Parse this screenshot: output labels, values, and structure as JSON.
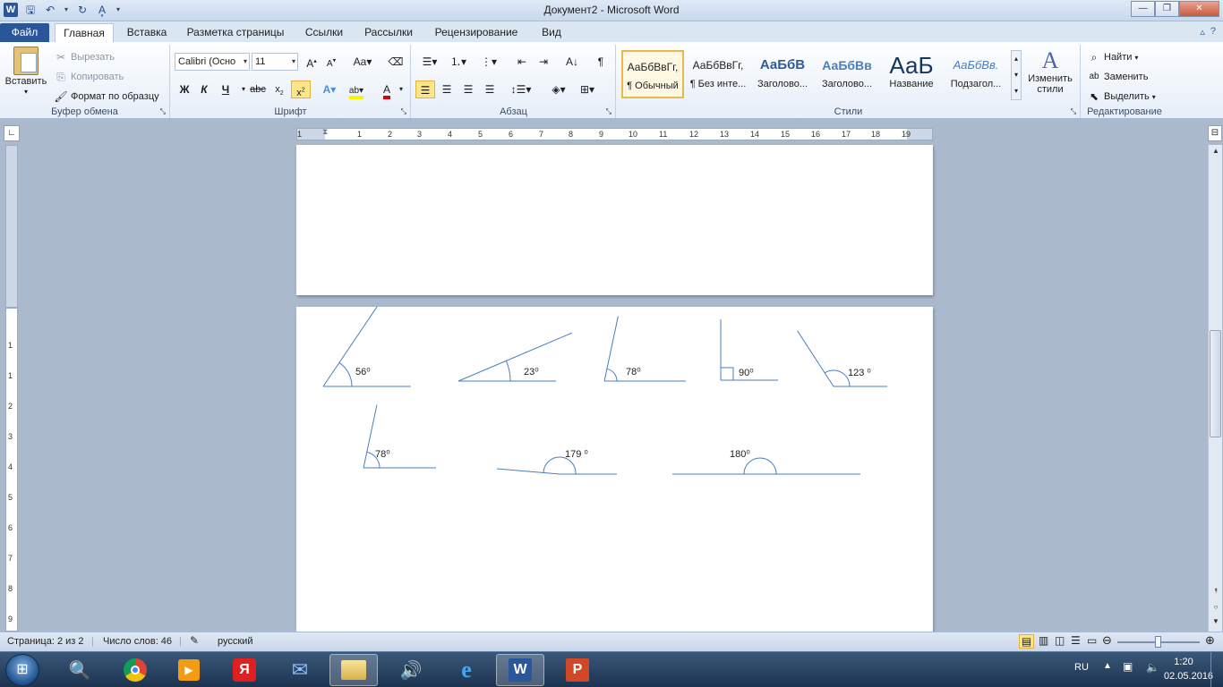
{
  "title_bar": {
    "window_title": "Документ2  -  Microsoft Word",
    "minimize": "—",
    "maximize": "❐",
    "close": "✕"
  },
  "tabs": [
    {
      "label": "Файл"
    },
    {
      "label": "Главная"
    },
    {
      "label": "Вставка"
    },
    {
      "label": "Разметка страницы"
    },
    {
      "label": "Ссылки"
    },
    {
      "label": "Рассылки"
    },
    {
      "label": "Рецензирование"
    },
    {
      "label": "Вид"
    }
  ],
  "ribbon": {
    "clipboard": {
      "label": "Буфер обмена",
      "paste": "Вставить",
      "cut": "Вырезать",
      "copy": "Копировать",
      "format_painter": "Формат по образцу"
    },
    "font": {
      "label": "Шрифт",
      "font_name": "Calibri (Осно",
      "font_size": "11"
    },
    "paragraph": {
      "label": "Абзац"
    },
    "styles": {
      "label": "Стили",
      "items": [
        {
          "sample": "АаБбВвГг,",
          "name": "¶ Обычный"
        },
        {
          "sample": "АаБбВвГг,",
          "name": "¶ Без инте..."
        },
        {
          "sample": "АаБбВ",
          "name": "Заголово..."
        },
        {
          "sample": "АаБбВв",
          "name": "Заголово..."
        },
        {
          "sample": "АаБ",
          "name": "Название"
        },
        {
          "sample": "АаБбВв.",
          "name": "Подзагол..."
        }
      ],
      "change_styles": "Изменить стили"
    },
    "editing": {
      "label": "Редактирование",
      "find": "Найти",
      "replace": "Заменить",
      "select": "Выделить"
    }
  },
  "ruler": {
    "labels": [
      "1",
      "1",
      "2",
      "3",
      "4",
      "5",
      "6",
      "7",
      "8",
      "9",
      "10",
      "11",
      "12",
      "13",
      "14",
      "15",
      "16",
      "17",
      "18",
      "19"
    ],
    "vertical_labels": [
      "1",
      "1",
      "2",
      "3",
      "4",
      "5",
      "6",
      "7",
      "8",
      "9"
    ]
  },
  "document": {
    "angles": [
      {
        "label": "56⁰",
        "degrees": 56
      },
      {
        "label": "23⁰",
        "degrees": 23
      },
      {
        "label": "78⁰",
        "degrees": 78
      },
      {
        "label": "90⁰",
        "degrees": 90
      },
      {
        "label": "123 ⁰",
        "degrees": 123
      },
      {
        "label": "78⁰",
        "degrees": 78
      },
      {
        "label": "179 ⁰",
        "degrees": 179
      },
      {
        "label": "180⁰",
        "degrees": 180
      }
    ],
    "line_color": "#4a7ebb"
  },
  "status_bar": {
    "page": "Страница: 2 из 2",
    "words": "Число слов: 46",
    "language": "русский",
    "zoom_fraction": 0.5
  },
  "taskbar": {
    "language": "RU",
    "time": "1:20",
    "date": "02.05.2016",
    "apps": [
      "magnifier",
      "chrome",
      "media-player",
      "yandex",
      "mail",
      "explorer",
      "sound",
      "internet-explorer",
      "word",
      "powerpoint"
    ]
  }
}
